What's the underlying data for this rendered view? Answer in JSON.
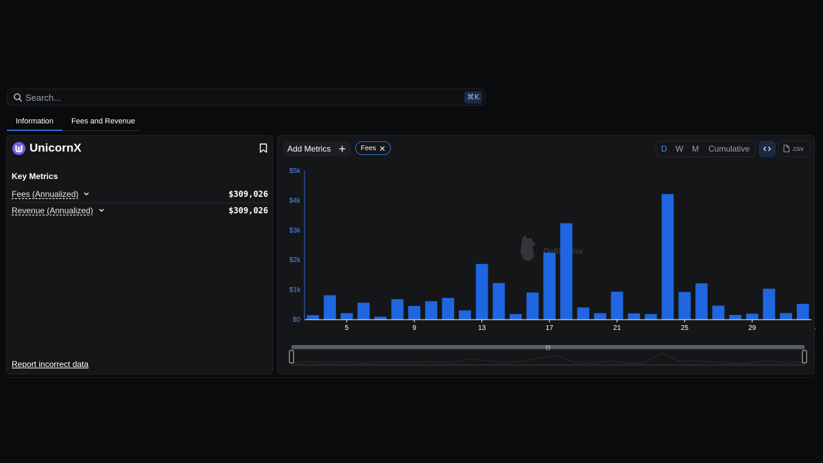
{
  "search": {
    "placeholder": "Search...",
    "shortcut": "⌘K"
  },
  "tabs": [
    {
      "label": "Information",
      "active": true
    },
    {
      "label": "Fees and Revenue",
      "active": false
    }
  ],
  "protocol": {
    "name": "UnicornX",
    "logo_color": "#7b5fd6"
  },
  "key_metrics": {
    "title": "Key Metrics",
    "rows": [
      {
        "label": "Fees (Annualized)",
        "value": "$309,026"
      },
      {
        "label": "Revenue (Annualized)",
        "value": "$309,026"
      }
    ]
  },
  "report_link": "Report incorrect data",
  "chart_toolbar": {
    "add_metrics_label": "Add Metrics",
    "chip_label": "Fees",
    "periods": [
      "D",
      "W",
      "M",
      "Cumulative"
    ],
    "active_period": "D",
    "csv_label": ".csv"
  },
  "watermark": "DefiLlama",
  "colors": {
    "accent": "#2f6fdb",
    "bar": "#1f66e0",
    "axis_text": "#4f8ef7"
  },
  "chart_data": {
    "type": "bar",
    "x": [
      "Jun 3",
      "Jun 4",
      "Jun 5",
      "Jun 6",
      "Jun 7",
      "Jun 8",
      "Jun 9",
      "Jun 10",
      "Jun 11",
      "Jun 12",
      "Jun 13",
      "Jun 14",
      "Jun 15",
      "Jun 16",
      "Jun 17",
      "Jun 18",
      "Jun 19",
      "Jun 20",
      "Jun 21",
      "Jun 22",
      "Jun 23",
      "Jun 24",
      "Jun 25",
      "Jun 26",
      "Jun 27",
      "Jun 28",
      "Jun 29",
      "Jun 30",
      "Jul 1"
    ],
    "series": [
      {
        "name": "Fees",
        "values": [
          150,
          820,
          220,
          570,
          100,
          690,
          460,
          620,
          730,
          310,
          1870,
          1230,
          190,
          910,
          2250,
          3240,
          410,
          220,
          940,
          210,
          190,
          4220,
          930,
          1220,
          470,
          160,
          200,
          1040,
          220,
          530
        ]
      }
    ],
    "x_tick_labels": [
      "5",
      "9",
      "13",
      "17",
      "21",
      "25",
      "29",
      "Jul"
    ],
    "y_tick_labels": [
      "$0",
      "$1k",
      "$2k",
      "$3k",
      "$4k",
      "$5k"
    ],
    "ylim": [
      0,
      5000
    ],
    "grid": false,
    "legend": "none"
  }
}
